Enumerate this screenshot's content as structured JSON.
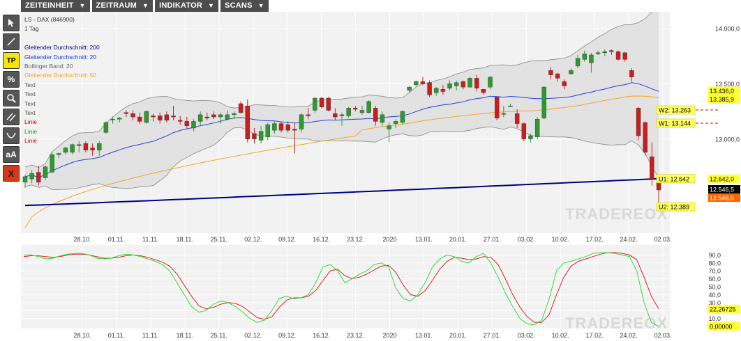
{
  "menubar": {
    "items": [
      {
        "label": "ZEITEINHEIT"
      },
      {
        "label": "ZEITRAUM"
      },
      {
        "label": "INDIKATOR"
      },
      {
        "label": "SCANS"
      }
    ]
  },
  "toolbar": {
    "tools": [
      {
        "icon": "cursor-icon",
        "label": ""
      },
      {
        "icon": "line-icon",
        "label": ""
      },
      {
        "icon": "tp-icon",
        "label": "TP"
      },
      {
        "icon": "percent-icon",
        "label": "%"
      },
      {
        "icon": "search-icon",
        "label": ""
      },
      {
        "icon": "parallel-lines-icon",
        "label": ""
      },
      {
        "icon": "arc-icon",
        "label": ""
      },
      {
        "icon": "font-size-icon",
        "label": "aA"
      },
      {
        "icon": "delete-icon",
        "label": "X"
      }
    ]
  },
  "legend": [
    {
      "text": "LS - DAX (846900)",
      "color": "#333333"
    },
    {
      "text": "1 Tag",
      "color": "#333333"
    },
    {
      "text": "",
      "color": "#333333"
    },
    {
      "text": "Gleitender Durchschnitt: 200",
      "color": "#000080"
    },
    {
      "text": "Gleitender Durchschnitt: 20",
      "color": "#1a35d4"
    },
    {
      "text": "Bollinger Band: 20",
      "color": "#666666"
    },
    {
      "text": "Gleitender Durchschnitt: 50",
      "color": "#f5a623"
    },
    {
      "text": "Text",
      "color": "#555555"
    },
    {
      "text": "Text",
      "color": "#555555"
    },
    {
      "text": "Text",
      "color": "#555555"
    },
    {
      "text": "Text",
      "color": "#555555"
    },
    {
      "text": "Linie",
      "color": "#d40000"
    },
    {
      "text": "Linie",
      "color": "#00b000"
    },
    {
      "text": "Linie",
      "color": "#d40000"
    }
  ],
  "watermark": "TRADEREOX",
  "colors": {
    "up": "#2e9a2e",
    "down": "#c81e1e",
    "ma200": "#000080",
    "ma20": "#2040e0",
    "ma50": "#f5a623",
    "bollinger_fill": "#e2e2e2",
    "stoch_k": "#33dd33",
    "stoch_d": "#dd2020"
  },
  "chart_data": [
    {
      "type": "candlestick",
      "instrument": "LS - DAX (846900)",
      "timeframe": "1 Tag",
      "ylim": [
        12150,
        14150
      ],
      "yticks": [
        {
          "value": 14000,
          "label": "14.000,0"
        },
        {
          "value": 13500,
          "label": "13.500,0"
        },
        {
          "value": 13000,
          "label": "13.000,0"
        }
      ],
      "xticks": [
        "28.10.",
        "01.11.",
        "11.11.",
        "18.11.",
        "25.11.",
        "02.12.",
        "09.12.",
        "16.12.",
        "23.12.",
        "2020",
        "13.01.",
        "20.01.",
        "27.01.",
        "03.02.",
        "10.02.",
        "17.02.",
        "24.02.",
        "02.03."
      ],
      "candles": [
        {
          "o": 12610,
          "h": 12680,
          "l": 12560,
          "c": 12660
        },
        {
          "o": 12640,
          "h": 12720,
          "l": 12600,
          "c": 12690
        },
        {
          "o": 12700,
          "h": 12760,
          "l": 12580,
          "c": 12610
        },
        {
          "o": 12650,
          "h": 12760,
          "l": 12630,
          "c": 12750
        },
        {
          "o": 12700,
          "h": 12880,
          "l": 12700,
          "c": 12860
        },
        {
          "o": 12860,
          "h": 12880,
          "l": 12830,
          "c": 12870
        },
        {
          "o": 12880,
          "h": 12930,
          "l": 12860,
          "c": 12920
        },
        {
          "o": 12880,
          "h": 12960,
          "l": 12860,
          "c": 12950
        },
        {
          "o": 12940,
          "h": 12980,
          "l": 12880,
          "c": 12950
        },
        {
          "o": 12960,
          "h": 12980,
          "l": 12880,
          "c": 12900
        },
        {
          "o": 12920,
          "h": 12960,
          "l": 12850,
          "c": 12900
        },
        {
          "o": 12900,
          "h": 12980,
          "l": 12850,
          "c": 12960
        },
        {
          "o": 13060,
          "h": 13160,
          "l": 13050,
          "c": 13150
        },
        {
          "o": 13180,
          "h": 13200,
          "l": 13140,
          "c": 13180
        },
        {
          "o": 13180,
          "h": 13200,
          "l": 13150,
          "c": 13190
        },
        {
          "o": 13240,
          "h": 13260,
          "l": 13200,
          "c": 13230
        },
        {
          "o": 13230,
          "h": 13260,
          "l": 13170,
          "c": 13200
        },
        {
          "o": 13200,
          "h": 13240,
          "l": 13140,
          "c": 13160
        },
        {
          "o": 13150,
          "h": 13260,
          "l": 13140,
          "c": 13250
        },
        {
          "o": 13210,
          "h": 13230,
          "l": 13160,
          "c": 13200
        },
        {
          "o": 13210,
          "h": 13240,
          "l": 13140,
          "c": 13170
        },
        {
          "o": 13220,
          "h": 13250,
          "l": 13150,
          "c": 13170
        },
        {
          "o": 13210,
          "h": 13300,
          "l": 13170,
          "c": 13200
        },
        {
          "o": 13170,
          "h": 13210,
          "l": 13130,
          "c": 13160
        },
        {
          "o": 13160,
          "h": 13200,
          "l": 13090,
          "c": 13120
        },
        {
          "o": 13100,
          "h": 13180,
          "l": 13070,
          "c": 13160
        },
        {
          "o": 13160,
          "h": 13250,
          "l": 13120,
          "c": 13220
        },
        {
          "o": 13200,
          "h": 13240,
          "l": 13170,
          "c": 13190
        },
        {
          "o": 13220,
          "h": 13250,
          "l": 13180,
          "c": 13200
        },
        {
          "o": 13200,
          "h": 13240,
          "l": 13140,
          "c": 13220
        },
        {
          "o": 13180,
          "h": 13260,
          "l": 13170,
          "c": 13220
        },
        {
          "o": 13220,
          "h": 13250,
          "l": 13180,
          "c": 13230
        },
        {
          "o": 13320,
          "h": 13340,
          "l": 13230,
          "c": 13240
        },
        {
          "o": 13300,
          "h": 13360,
          "l": 12970,
          "c": 13000
        },
        {
          "o": 13050,
          "h": 13100,
          "l": 12960,
          "c": 13000
        },
        {
          "o": 12990,
          "h": 13120,
          "l": 12960,
          "c": 13070
        },
        {
          "o": 13020,
          "h": 13150,
          "l": 12990,
          "c": 13130
        },
        {
          "o": 13080,
          "h": 13160,
          "l": 13050,
          "c": 13140
        },
        {
          "o": 13140,
          "h": 13160,
          "l": 13060,
          "c": 13080
        },
        {
          "o": 13130,
          "h": 13160,
          "l": 13060,
          "c": 13080
        },
        {
          "o": 13090,
          "h": 13150,
          "l": 12870,
          "c": 13080
        },
        {
          "o": 13090,
          "h": 13230,
          "l": 13060,
          "c": 13220
        },
        {
          "o": 13220,
          "h": 13280,
          "l": 13180,
          "c": 13210
        },
        {
          "o": 13260,
          "h": 13380,
          "l": 13240,
          "c": 13370
        },
        {
          "o": 13370,
          "h": 13380,
          "l": 13280,
          "c": 13290
        },
        {
          "o": 13370,
          "h": 13380,
          "l": 13250,
          "c": 13260
        },
        {
          "o": 13230,
          "h": 13280,
          "l": 13170,
          "c": 13200
        },
        {
          "o": 13210,
          "h": 13240,
          "l": 13120,
          "c": 13220
        },
        {
          "o": 13210,
          "h": 13290,
          "l": 13190,
          "c": 13280
        },
        {
          "o": 13280,
          "h": 13300,
          "l": 13250,
          "c": 13270
        },
        {
          "o": 13240,
          "h": 13300,
          "l": 13220,
          "c": 13260
        },
        {
          "o": 13240,
          "h": 13350,
          "l": 13230,
          "c": 13340
        },
        {
          "o": 13280,
          "h": 13300,
          "l": 13120,
          "c": 13160
        },
        {
          "o": 13150,
          "h": 13250,
          "l": 13120,
          "c": 13220
        },
        {
          "o": 13090,
          "h": 13150,
          "l": 12970,
          "c": 13120
        },
        {
          "o": 13140,
          "h": 13180,
          "l": 13100,
          "c": 13160
        },
        {
          "o": 13150,
          "h": 13260,
          "l": 13130,
          "c": 13250
        },
        {
          "o": 13440,
          "h": 13480,
          "l": 13420,
          "c": 13470
        },
        {
          "o": 13490,
          "h": 13530,
          "l": 13480,
          "c": 13520
        },
        {
          "o": 13520,
          "h": 13560,
          "l": 13490,
          "c": 13500
        },
        {
          "o": 13510,
          "h": 13530,
          "l": 13380,
          "c": 13400
        },
        {
          "o": 13420,
          "h": 13470,
          "l": 13390,
          "c": 13460
        },
        {
          "o": 13450,
          "h": 13490,
          "l": 13400,
          "c": 13430
        },
        {
          "o": 13460,
          "h": 13530,
          "l": 13440,
          "c": 13500
        },
        {
          "o": 13480,
          "h": 13530,
          "l": 13440,
          "c": 13510
        },
        {
          "o": 13520,
          "h": 13530,
          "l": 13450,
          "c": 13470
        },
        {
          "o": 13470,
          "h": 13560,
          "l": 13460,
          "c": 13550
        },
        {
          "o": 13550,
          "h": 13580,
          "l": 13430,
          "c": 13460
        },
        {
          "o": 13450,
          "h": 13450,
          "l": 13400,
          "c": 13420
        },
        {
          "o": 13470,
          "h": 13570,
          "l": 13450,
          "c": 13560
        },
        {
          "o": 13380,
          "h": 13380,
          "l": 13170,
          "c": 13190
        },
        {
          "o": 13230,
          "h": 13300,
          "l": 13200,
          "c": 13230
        },
        {
          "o": 13300,
          "h": 13320,
          "l": 13290,
          "c": 13300
        },
        {
          "o": 13230,
          "h": 13270,
          "l": 13100,
          "c": 13140
        },
        {
          "o": 13140,
          "h": 13150,
          "l": 12980,
          "c": 13000
        },
        {
          "o": 13000,
          "h": 13050,
          "l": 12970,
          "c": 13030
        },
        {
          "o": 13020,
          "h": 13200,
          "l": 13000,
          "c": 13180
        },
        {
          "o": 13190,
          "h": 13480,
          "l": 13180,
          "c": 13470
        },
        {
          "o": 13620,
          "h": 13650,
          "l": 13540,
          "c": 13580
        },
        {
          "o": 13590,
          "h": 13600,
          "l": 13520,
          "c": 13550
        },
        {
          "o": 13520,
          "h": 13540,
          "l": 13450,
          "c": 13480
        },
        {
          "o": 13590,
          "h": 13640,
          "l": 13580,
          "c": 13620
        },
        {
          "o": 13660,
          "h": 13760,
          "l": 13640,
          "c": 13730
        },
        {
          "o": 13720,
          "h": 13800,
          "l": 13700,
          "c": 13770
        },
        {
          "o": 13690,
          "h": 13780,
          "l": 13600,
          "c": 13760
        },
        {
          "o": 13770,
          "h": 13800,
          "l": 13760,
          "c": 13780
        },
        {
          "o": 13780,
          "h": 13810,
          "l": 13750,
          "c": 13790
        },
        {
          "o": 13800,
          "h": 13810,
          "l": 13760,
          "c": 13790
        },
        {
          "o": 13790,
          "h": 13800,
          "l": 13710,
          "c": 13720
        },
        {
          "o": 13780,
          "h": 13790,
          "l": 13700,
          "c": 13720
        },
        {
          "o": 13620,
          "h": 13640,
          "l": 13520,
          "c": 13560
        },
        {
          "o": 13280,
          "h": 13290,
          "l": 12990,
          "c": 13030
        },
        {
          "o": 13150,
          "h": 13160,
          "l": 12850,
          "c": 12880
        },
        {
          "o": 12840,
          "h": 12970,
          "l": 12580,
          "c": 12640
        },
        {
          "o": 12640,
          "h": 12660,
          "l": 12390,
          "c": 12540
        }
      ],
      "overlays": {
        "ma200": {
          "from": 12400,
          "to": 12642
        },
        "ma20": {
          "from": 12400,
          "to": 13436
        },
        "ma50": {
          "from": 12200,
          "to": 13385
        }
      },
      "price_labels": [
        {
          "text": "13.436,0",
          "value": 13436,
          "color": "#ffff33",
          "text_color": "#000000"
        },
        {
          "text": "13.385,9",
          "value": 13385,
          "color": "#ffff33",
          "text_color": "#000000"
        },
        {
          "text": "12.642,0",
          "value": 12642,
          "color": "#ffff33",
          "text_color": "#000000"
        },
        {
          "text": "12.546,5",
          "value": 12546,
          "color": "#000000",
          "text_color": "#ffffff"
        },
        {
          "text": "12.546,0",
          "value": 12520,
          "color": "#ff6600",
          "text_color": "#ffffff"
        }
      ],
      "levels": [
        {
          "label": "W2: 13.263",
          "value": 13263,
          "line": "dashed-red"
        },
        {
          "label": "W1: 13.144",
          "value": 13144,
          "line": "dashed-red"
        },
        {
          "label": "U1: 12.642",
          "value": 12642,
          "line": "none"
        },
        {
          "label": "U2: 12.389",
          "value": 12389,
          "line": "none"
        }
      ]
    },
    {
      "type": "line",
      "indicator": "stochastic",
      "ylim": [
        0,
        100
      ],
      "yticks": [
        "90,0",
        "80,0",
        "70,0",
        "60,0",
        "50,0",
        "40,0",
        "30,0",
        "20,0",
        "10,0"
      ],
      "xticks": [
        "28.10.",
        "01.11.",
        "11.11.",
        "18.11.",
        "25.11.",
        "02.12.",
        "09.12.",
        "16.12.",
        "23.12.",
        "2020",
        "13.01.",
        "20.01.",
        "27.01.",
        "03.02.",
        "10.02.",
        "17.02.",
        "24.02.",
        "02.03."
      ],
      "series": [
        {
          "values": [
            90,
            90,
            88,
            85,
            86,
            89,
            91,
            92,
            92,
            90,
            86,
            85,
            86,
            89,
            91,
            90,
            88,
            85,
            82,
            78,
            70,
            55,
            40,
            25,
            18,
            20,
            28,
            32,
            30,
            25,
            18,
            10,
            5,
            8,
            20,
            35,
            38,
            35,
            36,
            40,
            55,
            75,
            78,
            70,
            55,
            60,
            66,
            70,
            78,
            80,
            75,
            48,
            35,
            32,
            40,
            55,
            75,
            85,
            90,
            88,
            82,
            80,
            88,
            92,
            80,
            62,
            42,
            25,
            10,
            3,
            2,
            8,
            35,
            70,
            80,
            82,
            85,
            88,
            92,
            93,
            93,
            92,
            90,
            88,
            70,
            30,
            5,
            0
          ]
        },
        {
          "values": [
            88,
            89,
            89,
            88,
            87,
            88,
            90,
            91,
            91,
            90,
            88,
            86,
            86,
            87,
            89,
            90,
            89,
            87,
            84,
            81,
            76,
            66,
            52,
            38,
            26,
            22,
            24,
            28,
            30,
            29,
            25,
            18,
            11,
            9,
            12,
            24,
            33,
            36,
            36,
            38,
            45,
            58,
            70,
            72,
            64,
            60,
            62,
            66,
            71,
            76,
            77,
            68,
            52,
            40,
            38,
            45,
            58,
            72,
            82,
            87,
            86,
            84,
            85,
            88,
            87,
            78,
            60,
            40,
            24,
            12,
            5,
            5,
            15,
            40,
            62,
            76,
            82,
            85,
            88,
            91,
            93,
            93,
            92,
            90,
            84,
            62,
            38,
            22
          ]
        }
      ],
      "value_labels": [
        {
          "text": "22,26725",
          "color": "#ffff33"
        },
        {
          "text": "0,00000",
          "color": "#ffff33"
        }
      ]
    }
  ]
}
